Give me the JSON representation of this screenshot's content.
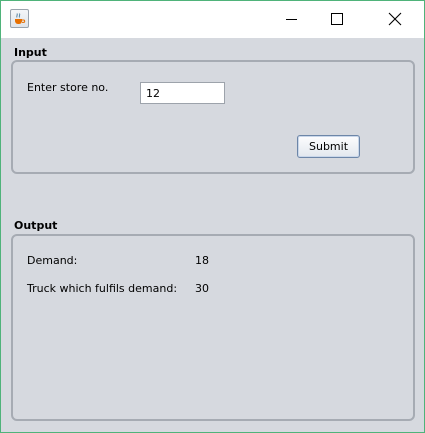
{
  "window": {
    "app_icon": "java-cup-icon",
    "controls": [
      "minimize-icon",
      "maximize-icon",
      "close-icon"
    ]
  },
  "input_group": {
    "title": "Input",
    "store_label": "Enter store no.",
    "store_value": "12",
    "submit_label": "Submit"
  },
  "output_group": {
    "title": "Output",
    "demand_label": "Demand:",
    "demand_value": "18",
    "truck_label": "Truck which fulfils demand:",
    "truck_value": "30"
  },
  "colors": {
    "window_bg": "#d6d9df",
    "titlebar_bg": "#ffffff",
    "window_border": "#4fb37a",
    "button_border": "#6d86a8"
  }
}
